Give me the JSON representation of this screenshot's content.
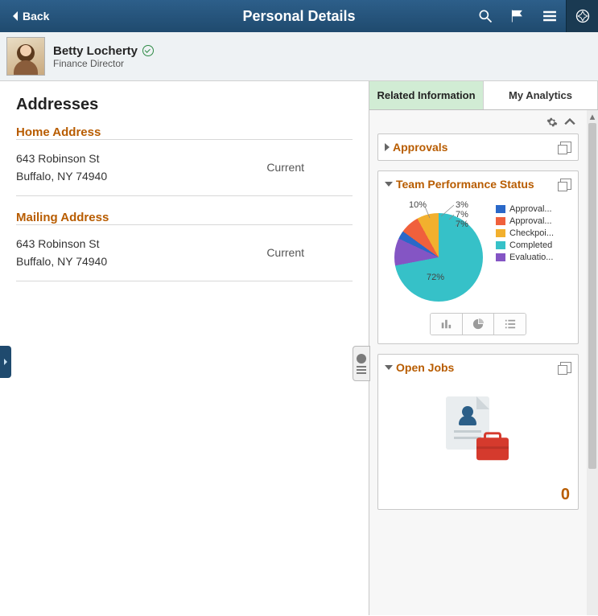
{
  "header": {
    "back_label": "Back",
    "title": "Personal Details"
  },
  "person": {
    "name": "Betty Locherty",
    "job_title": "Finance Director"
  },
  "page": {
    "heading": "Addresses"
  },
  "addresses": [
    {
      "label": "Home Address",
      "line1": "643 Robinson St",
      "line2": "Buffalo, NY 74940",
      "status": "Current"
    },
    {
      "label": "Mailing Address",
      "line1": "643 Robinson St",
      "line2": "Buffalo, NY 74940",
      "status": "Current"
    }
  ],
  "side": {
    "tabs": [
      {
        "label": "Related Information",
        "active": true
      },
      {
        "label": "My Analytics",
        "active": false
      }
    ],
    "panels": {
      "approvals": {
        "title": "Approvals",
        "expanded": false
      },
      "team_perf": {
        "title": "Team Performance Status",
        "expanded": true
      },
      "open_jobs": {
        "title": "Open Jobs",
        "expanded": true,
        "count": "0"
      }
    }
  },
  "chart_data": {
    "type": "pie",
    "title": "Team Performance Status",
    "series": [
      {
        "name": "Approval...",
        "value": 3,
        "color": "#2a68c8"
      },
      {
        "name": "Approval...",
        "value": 7,
        "color": "#f0603c"
      },
      {
        "name": "Checkpoi...",
        "value": 7,
        "color": "#f2b02e"
      },
      {
        "name": "Completed",
        "value": 72,
        "color": "#36c1c8"
      },
      {
        "name": "Evaluatio...",
        "value": 10,
        "color": "#8455c4"
      }
    ],
    "labels": [
      "3%",
      "7%",
      "7%",
      "72%",
      "10%"
    ]
  }
}
